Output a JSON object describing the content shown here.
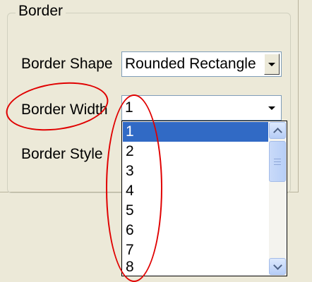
{
  "group": {
    "title": "Border"
  },
  "rows": {
    "shape": {
      "label": "Border Shape",
      "value": "Rounded Rectangle"
    },
    "width": {
      "label": "Border Width",
      "value": "1"
    },
    "style": {
      "label": "Border Style"
    }
  },
  "dropdown": {
    "items": [
      "1",
      "2",
      "3",
      "4",
      "5",
      "6",
      "7",
      "8"
    ],
    "selected": "1"
  },
  "colors": {
    "selection": "#316ac5",
    "annotation": "#e00000"
  },
  "icons": {
    "combo_arrow": "chevron-down-icon",
    "scroll_up": "chevron-up-icon",
    "scroll_down": "chevron-down-icon"
  }
}
